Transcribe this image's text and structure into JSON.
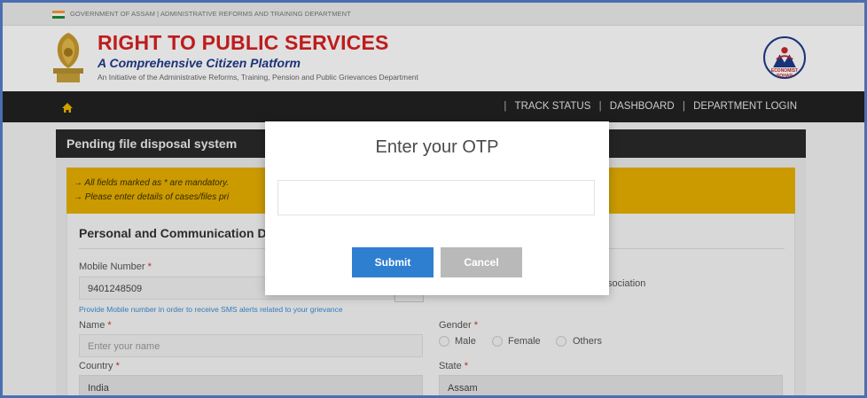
{
  "top_strip": {
    "text": "GOVERNMENT OF ASSAM | ADMINISTRATIVE REFORMS AND TRAINING DEPARTMENT"
  },
  "header": {
    "title": "RIGHT TO PUBLIC SERVICES",
    "subtitle": "A Comprehensive Citizen Platform",
    "initiative": "An Initiative of the Administrative Reforms, Training, Pension and Public Grievances Department",
    "right_logo_text": "ECONOMIST SOHAR"
  },
  "nav": {
    "home_icon": "home-icon",
    "links": [
      {
        "label": "TRACK STATUS"
      },
      {
        "label": "DASHBOARD"
      },
      {
        "label": "DEPARTMENT LOGIN"
      }
    ]
  },
  "panel": {
    "title": "Pending file disposal system"
  },
  "notice": {
    "line1": "→ All fields marked as * are mandatory.",
    "line2": "→ Please enter details of cases/files pri"
  },
  "form": {
    "section_title": "Personal and Communication D",
    "mobile": {
      "label": "Mobile Number",
      "value": "9401248509"
    },
    "mobile_help": "Provide Mobile number in order to receive SMS alerts related to your grievance",
    "association_fragment": "sociation",
    "name": {
      "label": "Name",
      "placeholder": "Enter your name"
    },
    "gender": {
      "label": "Gender",
      "options": [
        "Male",
        "Female",
        "Others"
      ]
    },
    "country": {
      "label": "Country",
      "value": "India"
    },
    "state": {
      "label": "State",
      "value": "Assam"
    },
    "required_mark": "*"
  },
  "modal": {
    "title": "Enter your OTP",
    "otp_value": "",
    "submit_label": "Submit",
    "cancel_label": "Cancel"
  },
  "colors": {
    "title_red": "#d92020",
    "subtitle_blue": "#1e3a8a",
    "nav_bg": "#222222",
    "notice_yellow": "#e6b000",
    "submit_blue": "#2f7fd1",
    "cancel_grey": "#b9b9b9"
  }
}
